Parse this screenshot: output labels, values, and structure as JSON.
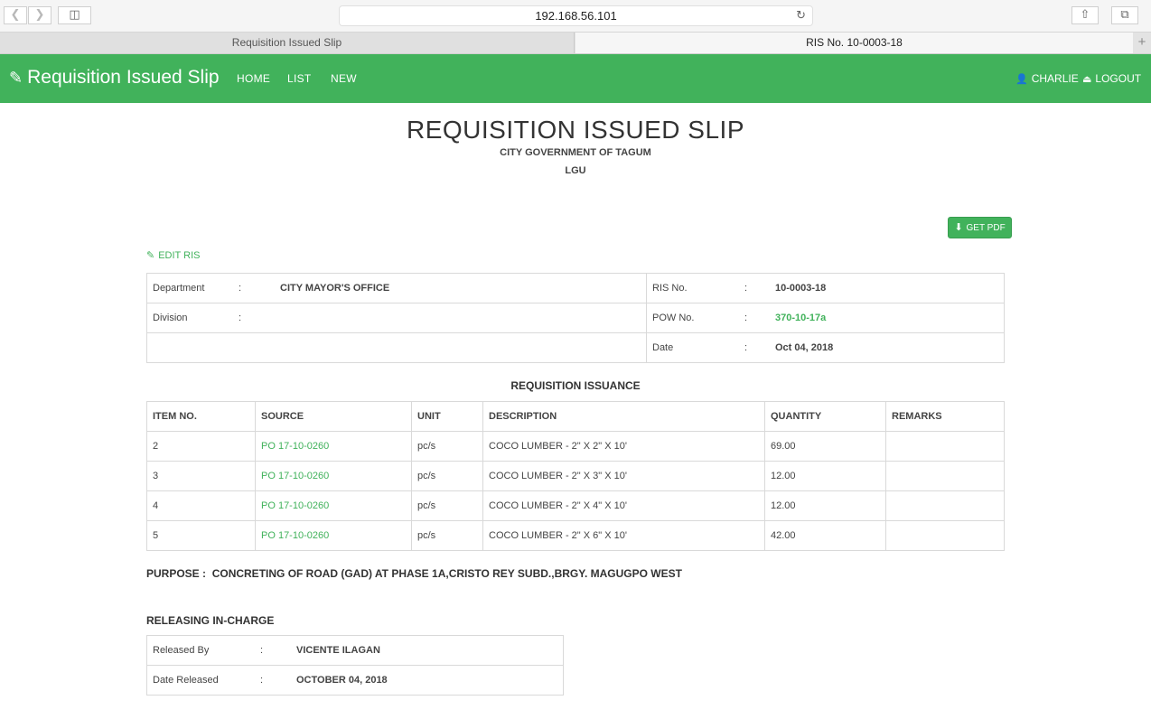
{
  "browser": {
    "url": "192.168.56.101",
    "tabs": [
      {
        "label": "Requisition Issued Slip"
      },
      {
        "label": "RIS No. 10-0003-18"
      }
    ]
  },
  "navbar": {
    "brand": "Requisition Issued Slip",
    "links": [
      "HOME",
      "LIST",
      "NEW"
    ],
    "user": "CHARLIE",
    "logout": "LOGOUT"
  },
  "header": {
    "title": "REQUISITION ISSUED SLIP",
    "org": "CITY GOVERNMENT OF TAGUM",
    "unit": "LGU"
  },
  "actions": {
    "get_pdf": "GET PDF",
    "edit": "EDIT RIS"
  },
  "info": {
    "department_label": "Department",
    "department": "CITY MAYOR'S OFFICE",
    "division_label": "Division",
    "division": "",
    "ris_label": "RIS No.",
    "ris_no": "10-0003-18",
    "pow_label": "POW No.",
    "pow_no": "370-10-17a",
    "date_label": "Date",
    "date": "Oct 04, 2018",
    "colon": ":"
  },
  "issuance": {
    "title": "REQUISITION ISSUANCE",
    "headers": [
      "ITEM NO.",
      "SOURCE",
      "UNIT",
      "DESCRIPTION",
      "QUANTITY",
      "REMARKS"
    ],
    "rows": [
      {
        "item": "2",
        "source": "PO 17-10-0260",
        "unit": "pc/s",
        "description": "COCO LUMBER - 2\" X 2\" X 10'",
        "quantity": "69.00",
        "remarks": ""
      },
      {
        "item": "3",
        "source": "PO 17-10-0260",
        "unit": "pc/s",
        "description": "COCO LUMBER - 2\" X 3\" X 10'",
        "quantity": "12.00",
        "remarks": ""
      },
      {
        "item": "4",
        "source": "PO 17-10-0260",
        "unit": "pc/s",
        "description": "COCO LUMBER - 2\" X 4\" X 10'",
        "quantity": "12.00",
        "remarks": ""
      },
      {
        "item": "5",
        "source": "PO 17-10-0260",
        "unit": "pc/s",
        "description": "COCO LUMBER - 2\" X 6\" X 10'",
        "quantity": "42.00",
        "remarks": ""
      }
    ]
  },
  "purpose": {
    "label": "PURPOSE :",
    "text": "CONCRETING OF ROAD (GAD) AT PHASE 1A,CRISTO REY SUBD.,BRGY. MAGUGPO WEST"
  },
  "releasing": {
    "title": "RELEASING IN-CHARGE",
    "released_by_label": "Released By",
    "released_by": "VICENTE ILAGAN",
    "date_released_label": "Date Released",
    "date_released": "OCTOBER 04, 2018"
  },
  "colors": {
    "accent": "#41b25b"
  }
}
